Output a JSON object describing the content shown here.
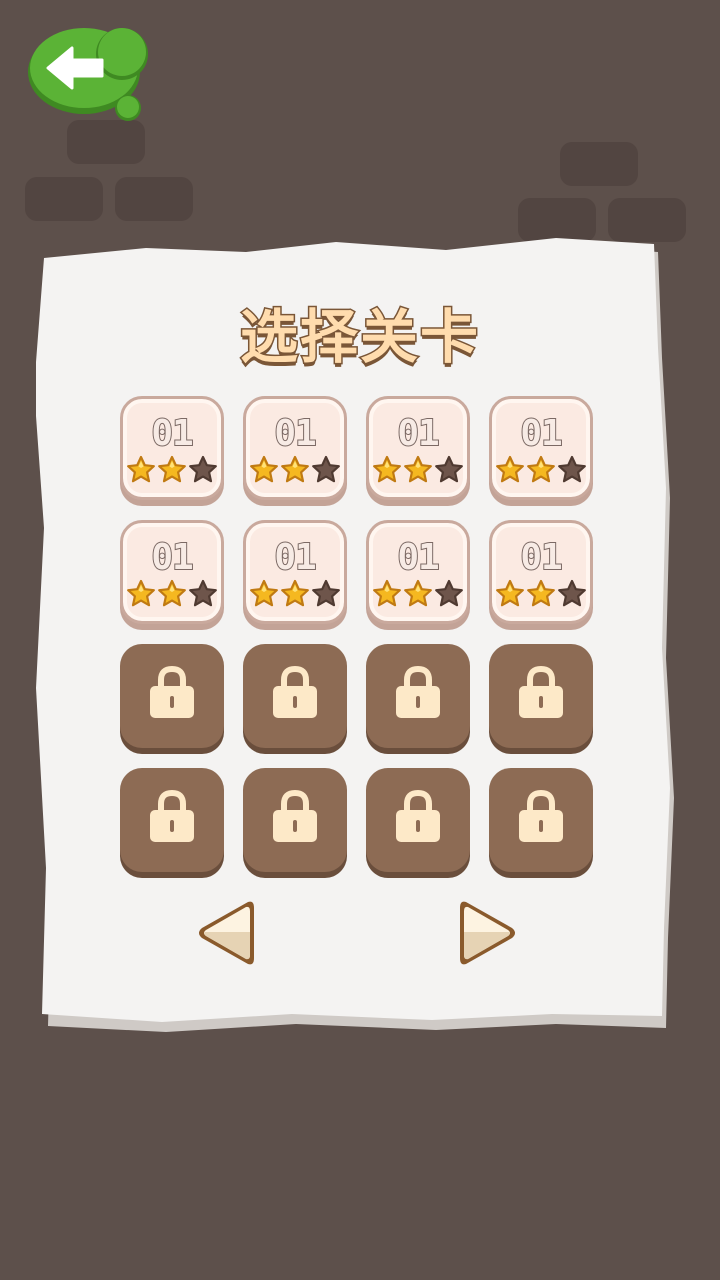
{
  "screen": {
    "title": "选择关卡"
  },
  "back_button": {
    "icon": "arrow-left-icon",
    "color": "#5bb336"
  },
  "levels": [
    {
      "label": "01",
      "stars": 2,
      "locked": false
    },
    {
      "label": "01",
      "stars": 2,
      "locked": false
    },
    {
      "label": "01",
      "stars": 2,
      "locked": false
    },
    {
      "label": "01",
      "stars": 2,
      "locked": false
    },
    {
      "label": "01",
      "stars": 2,
      "locked": false
    },
    {
      "label": "01",
      "stars": 2,
      "locked": false
    },
    {
      "label": "01",
      "stars": 2,
      "locked": false
    },
    {
      "label": "01",
      "stars": 2,
      "locked": false
    },
    {
      "label": "",
      "stars": 0,
      "locked": true
    },
    {
      "label": "",
      "stars": 0,
      "locked": true
    },
    {
      "label": "",
      "stars": 0,
      "locked": true
    },
    {
      "label": "",
      "stars": 0,
      "locked": true
    },
    {
      "label": "",
      "stars": 0,
      "locked": true
    },
    {
      "label": "",
      "stars": 0,
      "locked": true
    },
    {
      "label": "",
      "stars": 0,
      "locked": true
    },
    {
      "label": "",
      "stars": 0,
      "locked": true
    }
  ],
  "max_stars": 3,
  "pagination": {
    "prev_icon": "triangle-left-icon",
    "next_icon": "triangle-right-icon"
  },
  "colors": {
    "background": "#5d504b",
    "star_filled": "#f5b820",
    "star_empty": "#6e554b",
    "locked_tile": "#8d6b54",
    "lock_icon": "#fde9c8"
  }
}
